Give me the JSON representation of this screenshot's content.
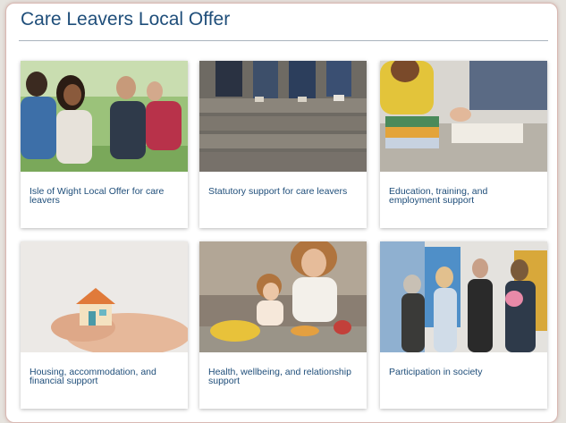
{
  "page": {
    "title": "Care Leavers Local Offer"
  },
  "cards": [
    {
      "label": "Isle of Wight Local Offer for care leavers",
      "image_icon": "group-of-young-people-photo"
    },
    {
      "label": "Statutory support for care leavers",
      "image_icon": "people-sitting-on-steps-photo"
    },
    {
      "label": "Education, training, and employment support",
      "image_icon": "students-studying-photo"
    },
    {
      "label": "Housing, accommodation, and financial support",
      "image_icon": "hands-holding-house-photo"
    },
    {
      "label": "Health, wellbeing, and relationship support",
      "image_icon": "family-cooking-photo"
    },
    {
      "label": "Participation in society",
      "image_icon": "group-meeting-photo"
    }
  ],
  "colors": {
    "title": "#1f4e7a",
    "link": "#1f4e7a",
    "panel_border": "#d9b9b3"
  }
}
